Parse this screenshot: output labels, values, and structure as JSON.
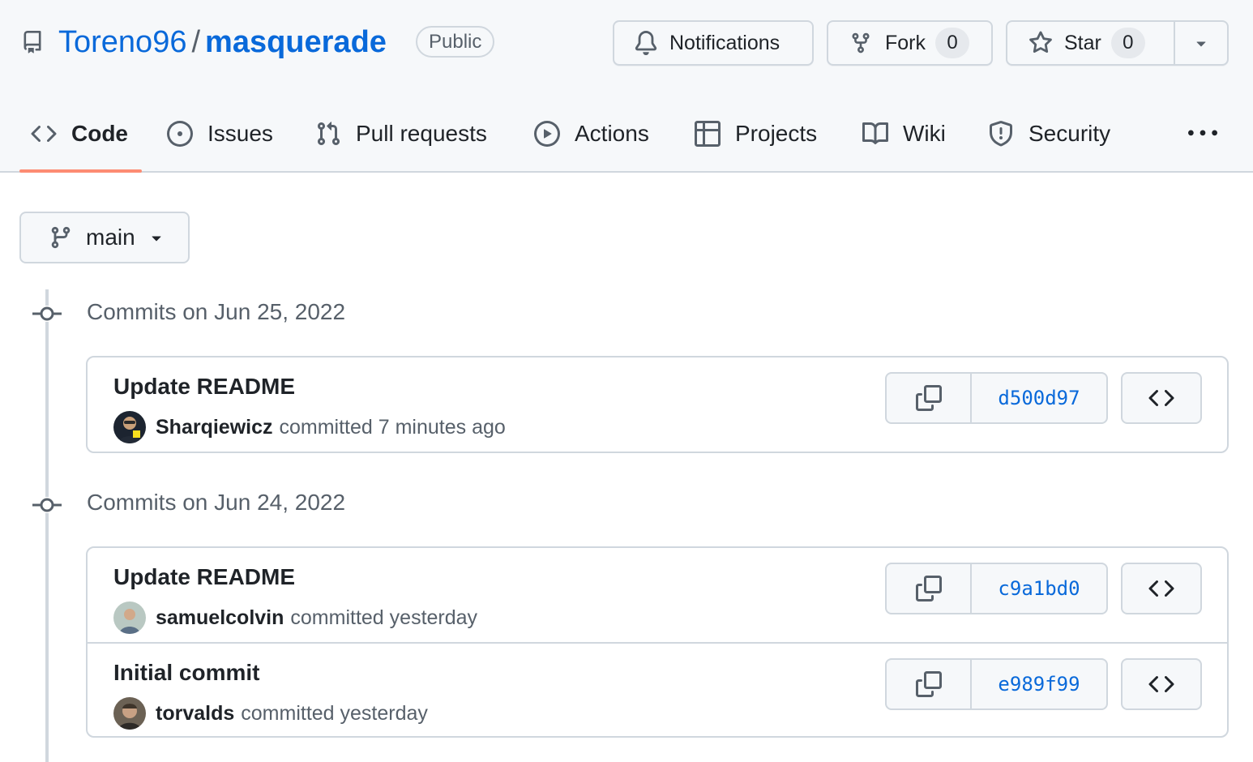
{
  "repo": {
    "owner": "Toreno96",
    "separator": "/",
    "name": "masquerade",
    "visibility": "Public"
  },
  "actions": {
    "notifications_label": "Notifications",
    "fork_label": "Fork",
    "fork_count": "0",
    "star_label": "Star",
    "star_count": "0"
  },
  "tabs": [
    {
      "label": "Code",
      "icon": "code-icon",
      "active": true
    },
    {
      "label": "Issues",
      "icon": "issue-opened-icon"
    },
    {
      "label": "Pull requests",
      "icon": "git-pull-request-icon"
    },
    {
      "label": "Actions",
      "icon": "play-icon"
    },
    {
      "label": "Projects",
      "icon": "table-icon"
    },
    {
      "label": "Wiki",
      "icon": "book-icon"
    },
    {
      "label": "Security",
      "icon": "shield-icon"
    }
  ],
  "branch": {
    "label": "main"
  },
  "commit_groups": [
    {
      "heading": "Commits on Jun 25, 2022",
      "commits": [
        {
          "title": "Update README",
          "author": "Sharqiewicz",
          "meta": "committed 7 minutes ago",
          "sha": "d500d97"
        }
      ]
    },
    {
      "heading": "Commits on Jun 24, 2022",
      "commits": [
        {
          "title": "Update README",
          "author": "samuelcolvin",
          "meta": "committed yesterday",
          "sha": "c9a1bd0"
        },
        {
          "title": "Initial commit",
          "author": "torvalds",
          "meta": "committed yesterday",
          "sha": "e989f99"
        }
      ]
    }
  ],
  "colors": {
    "link": "#0969da",
    "active_tab_underline": "#fd8c73",
    "border": "#d0d7de",
    "header_bg": "#f6f8fa"
  }
}
